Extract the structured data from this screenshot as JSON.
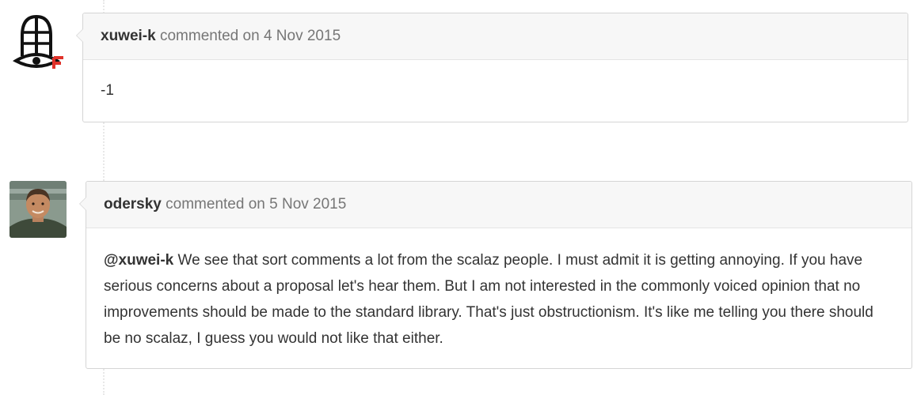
{
  "comments": [
    {
      "author": "xuwei-k",
      "action": "commented on",
      "date": "4 Nov 2015",
      "avatar_icon": "scala-parody-eye-logo-icon",
      "body": "-1"
    },
    {
      "author": "odersky",
      "action": "commented on",
      "date": "5 Nov 2015",
      "avatar_icon": "user-photo-avatar",
      "mention": "@xuwei-k",
      "body": " We see that sort comments a lot from the scalaz people. I must admit it is getting annoying. If you have serious concerns about a proposal let's hear them. But I am not interested in the commonly voiced opinion that no improvements should be made to the standard library. That's just obstructionism. It's like me telling you there should be no scalaz, I guess you would not like that either."
    }
  ],
  "colors": {
    "header_bg": "#f7f7f7",
    "border": "#d5d5d5",
    "text": "#333333",
    "muted": "#767676",
    "logo_red": "#e0322a"
  }
}
